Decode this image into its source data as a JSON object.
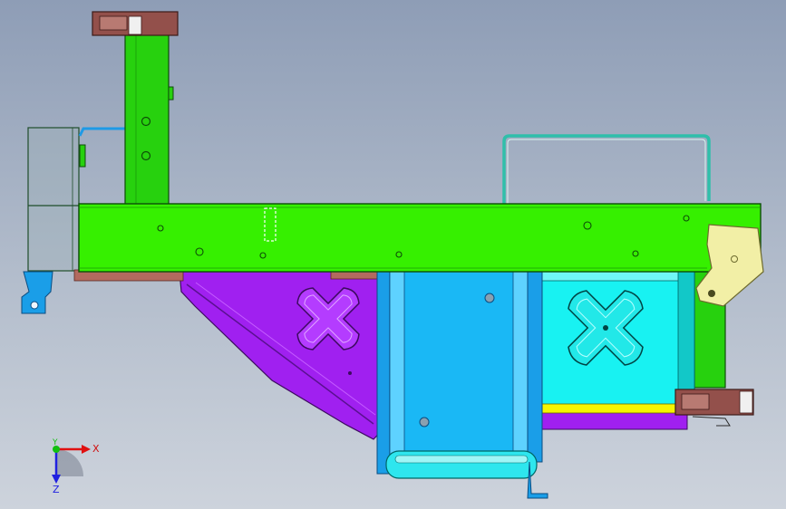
{
  "viewport": {
    "background_top": "#8e9db6",
    "background_bottom": "#cdd3dc"
  },
  "parts": {
    "main_beam_color": "#36f000",
    "vertical_post_color": "#27d10e",
    "gusset_color": "#a020f0",
    "center_channel_color": "#1ab8f5",
    "tank_color": "#18f2f2",
    "bracket_color": "#f2efa6",
    "cap_color": "#93504b",
    "strip_color": "#f5f500",
    "frame_rail_color": "#2fbfaa"
  },
  "triad": {
    "x_label": "X",
    "y_label": "Y",
    "z_label": "Z",
    "x_color": "#e01010",
    "y_color": "#10c010",
    "z_color": "#2020e0"
  }
}
